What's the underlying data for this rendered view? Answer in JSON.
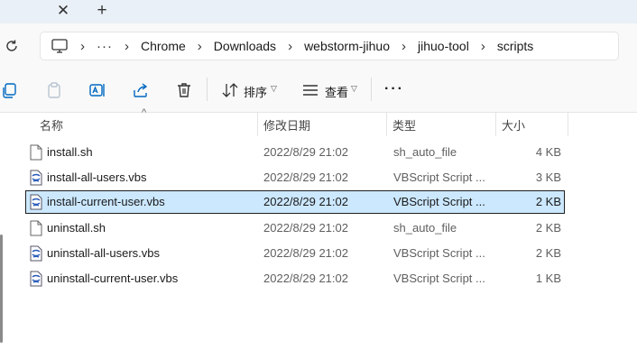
{
  "tabstrip": {
    "close_icon": "close-icon",
    "new_tab_icon": "plus-icon"
  },
  "address": {
    "refresh_icon": "refresh-icon",
    "pc_icon": "computer-icon",
    "ellipsis": "···",
    "crumbs": [
      "Chrome",
      "Downloads",
      "webstorm-jihuo",
      "jihuo-tool",
      "scripts"
    ]
  },
  "toolbar": {
    "sort_label": "排序",
    "view_label": "查看",
    "more_label": "···"
  },
  "columns": {
    "name": "名称",
    "modified": "修改日期",
    "type": "类型",
    "size": "大小"
  },
  "files": [
    {
      "name": "install.sh",
      "modified": "2022/8/29 21:02",
      "type": "sh_auto_file",
      "size": "4 KB",
      "icon": "generic-file-icon",
      "selected": false
    },
    {
      "name": "install-all-users.vbs",
      "modified": "2022/8/29 21:02",
      "type": "VBScript Script ...",
      "size": "3 KB",
      "icon": "vbscript-file-icon",
      "selected": false
    },
    {
      "name": "install-current-user.vbs",
      "modified": "2022/8/29 21:02",
      "type": "VBScript Script ...",
      "size": "2 KB",
      "icon": "vbscript-file-icon",
      "selected": true
    },
    {
      "name": "uninstall.sh",
      "modified": "2022/8/29 21:02",
      "type": "sh_auto_file",
      "size": "2 KB",
      "icon": "generic-file-icon",
      "selected": false
    },
    {
      "name": "uninstall-all-users.vbs",
      "modified": "2022/8/29 21:02",
      "type": "VBScript Script ...",
      "size": "2 KB",
      "icon": "vbscript-file-icon",
      "selected": false
    },
    {
      "name": "uninstall-current-user.vbs",
      "modified": "2022/8/29 21:02",
      "type": "VBScript Script ...",
      "size": "1 KB",
      "icon": "vbscript-file-icon",
      "selected": false
    }
  ],
  "colors": {
    "selection": "#cce8ff",
    "accent": "#0067c0",
    "tabstrip": "#eaf0f7"
  }
}
